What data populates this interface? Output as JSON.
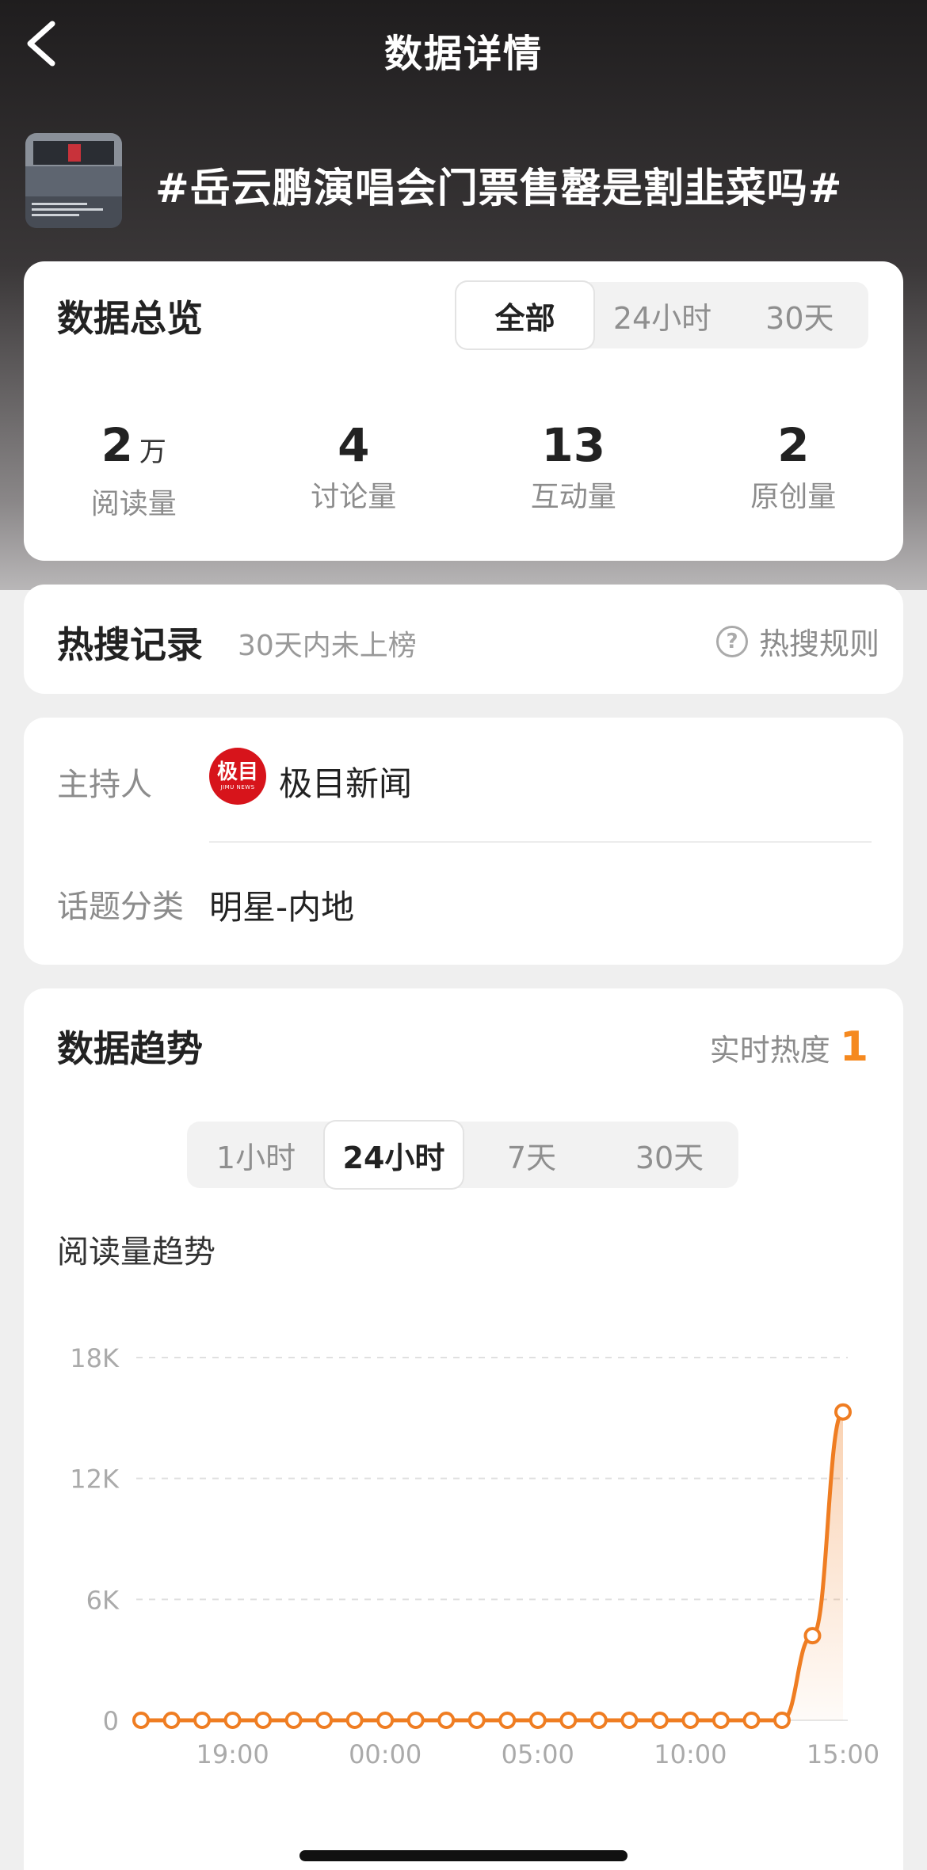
{
  "header": {
    "title": "数据详情",
    "back_icon": "chevron-left-icon"
  },
  "topic": {
    "title": "#岳云鹏演唱会门票售罄是割韭菜吗#"
  },
  "overview": {
    "title": "数据总览",
    "tabs": [
      {
        "label": "全部",
        "active": true
      },
      {
        "label": "24小时",
        "active": false
      },
      {
        "label": "30天",
        "active": false
      }
    ],
    "stats": [
      {
        "value": "2",
        "unit": "万",
        "label": "阅读量"
      },
      {
        "value": "4",
        "unit": "",
        "label": "讨论量"
      },
      {
        "value": "13",
        "unit": "",
        "label": "互动量"
      },
      {
        "value": "2",
        "unit": "",
        "label": "原创量"
      }
    ]
  },
  "hot_search": {
    "title": "热搜记录",
    "subtitle": "30天内未上榜",
    "rule_label": "热搜规则",
    "rule_icon": "question-circle-icon",
    "rule_icon_glyph": "?"
  },
  "host": {
    "host_label": "主持人",
    "host_name": "极目新闻",
    "logo_text": "极目",
    "logo_subtext": "JIMU NEWS",
    "category_label": "话题分类",
    "category_value": "明星-内地"
  },
  "trend": {
    "title": "数据趋势",
    "heat_label": "实时热度",
    "heat_value": "1",
    "tabs": [
      {
        "label": "1小时",
        "active": false
      },
      {
        "label": "24小时",
        "active": true
      },
      {
        "label": "7天",
        "active": false
      },
      {
        "label": "30天",
        "active": false
      }
    ],
    "chart_title": "阅读量趋势"
  },
  "colors": {
    "accent": "#f5891f",
    "line": "#ef7d22",
    "logo_red": "#d7141b"
  },
  "chart_data": {
    "type": "area",
    "title": "阅读量趋势",
    "xlabel": "",
    "ylabel": "",
    "x_tick_labels": [
      "19:00",
      "00:00",
      "05:00",
      "10:00",
      "15:00"
    ],
    "y_tick_labels": [
      "0",
      "6K",
      "12K",
      "18K"
    ],
    "y_ticks": [
      0,
      6000,
      12000,
      18000
    ],
    "ylim": [
      0,
      18000
    ],
    "grid": true,
    "legend": "none",
    "x": [
      "16:00",
      "17:00",
      "18:00",
      "19:00",
      "20:00",
      "21:00",
      "22:00",
      "23:00",
      "00:00",
      "01:00",
      "02:00",
      "03:00",
      "04:00",
      "05:00",
      "06:00",
      "07:00",
      "08:00",
      "09:00",
      "10:00",
      "11:00",
      "12:00",
      "13:00",
      "14:00",
      "15:00"
    ],
    "series": [
      {
        "values": [
          0,
          0,
          0,
          0,
          0,
          0,
          0,
          0,
          0,
          0,
          0,
          0,
          0,
          0,
          0,
          0,
          0,
          0,
          0,
          0,
          0,
          0,
          4200,
          15300
        ]
      }
    ]
  }
}
